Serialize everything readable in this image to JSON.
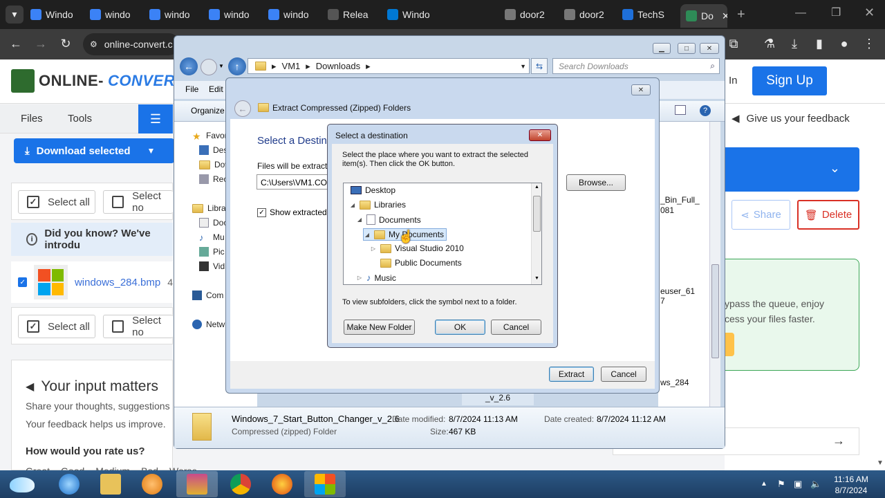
{
  "browser": {
    "tabs": [
      {
        "label": "Windo",
        "icon": "windows-site-icon"
      },
      {
        "label": "windo",
        "icon": "windows-site-icon"
      },
      {
        "label": "windo",
        "icon": "windows-site-icon"
      },
      {
        "label": "windo",
        "icon": "windows-site-icon"
      },
      {
        "label": "windo",
        "icon": "windows-site-icon"
      },
      {
        "label": "Relea",
        "icon": "github-icon"
      },
      {
        "label": "Windo",
        "icon": "windows-icon"
      },
      {
        "label": "door2",
        "icon": "door-icon"
      },
      {
        "label": "door2",
        "icon": "door-icon"
      },
      {
        "label": "TechS",
        "icon": "techspot-icon"
      },
      {
        "label": "Do",
        "icon": "online-convert-icon"
      }
    ],
    "url": "online-convert.c"
  },
  "site": {
    "logo_prefix": "ONLINE-",
    "logo_suffix": "CONVER",
    "signin": "In",
    "signup": "Sign Up",
    "nav_files": "Files",
    "nav_tools": "Tools",
    "download_selected": "Download selected",
    "select_all": "Select all",
    "select_none": "Select no",
    "did_you_know": "Did you know? We've introdu",
    "file_name": "windows_284.bmp",
    "file_size_prefix": "4",
    "feedback_title": "Your input matters",
    "feedback_line1": "Share your thoughts, suggestions",
    "feedback_line2": "Your feedback helps us improve.",
    "rate_question": "How would you rate us?",
    "rate_options": [
      "Great",
      "Good",
      "Medium",
      "Bad",
      "Worse"
    ],
    "give_feedback": "Give us your feedback",
    "share": "Share",
    "delete": "Delete",
    "premium_line1": "ypass the queue, enjoy",
    "premium_line2": "cess your files faster."
  },
  "explorer": {
    "breadcrumb": [
      "VM1",
      "Downloads"
    ],
    "search_placeholder": "Search Downloads",
    "menu": [
      "File",
      "Edit"
    ],
    "organize": "Organize",
    "nav_items": [
      "Favor",
      "Des",
      "Dow",
      "Rec",
      "Libra",
      "Doc",
      "Mu",
      "Pic",
      "Vid",
      "Com",
      "Netw"
    ],
    "files": [
      "_Bin_Full_",
      "081",
      "euser_61",
      "7",
      "ws_284",
      "_v_2.6"
    ],
    "detail_name": "Windows_7_Start_Button_Changer_v_2.6",
    "detail_type": "Compressed (zipped) Folder",
    "date_modified_label": "Date modified:",
    "date_modified": "8/7/2024 11:13 AM",
    "date_created_label": "Date created:",
    "date_created": "8/7/2024 11:12 AM",
    "size_label": "Size:",
    "size": "467 KB"
  },
  "wizard": {
    "title": "Extract Compressed (Zipped) Folders",
    "heading": "Select a Destin",
    "files_label": "Files will be extracte",
    "path": "C:\\Users\\VM1.CO",
    "browse": "Browse...",
    "show_extracted": "Show extracted f",
    "extract": "Extract",
    "cancel": "Cancel"
  },
  "dest": {
    "title": "Select a destination",
    "instructions": "Select the place where you want to extract the selected item(s).  Then click the OK button.",
    "tree": [
      "Desktop",
      "Libraries",
      "Documents",
      "My Documents",
      "Visual Studio 2010",
      "Public Documents",
      "Music"
    ],
    "hint": "To view subfolders, click the symbol next to a folder.",
    "make_folder": "Make New Folder",
    "ok": "OK",
    "cancel": "Cancel"
  },
  "taskbar": {
    "time": "11:16 AM",
    "date": "8/7/2024"
  }
}
